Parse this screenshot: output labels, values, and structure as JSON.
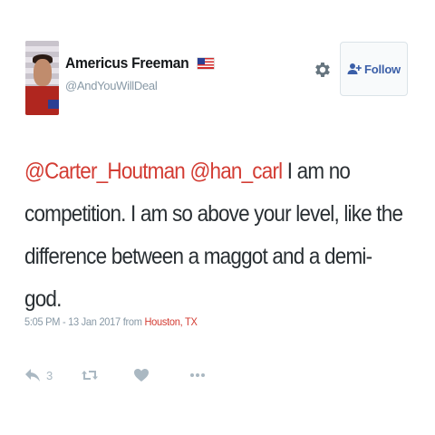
{
  "user": {
    "display_name": "Americus Freeman",
    "handle": "@AndYouWillDeal"
  },
  "follow_button": {
    "label": "Follow"
  },
  "tweet": {
    "mention1": "@Carter_Houtman",
    "mention2": "@han_carl",
    "text": " I am no competition. I am so above your level, like the difference between a maggot and a demi-god."
  },
  "meta": {
    "time_date": "5:05 PM - 13 Jan 2017 from ",
    "place": "Houston, TX"
  },
  "actions": {
    "reply_count": "3"
  },
  "icons": {
    "settings": "gear-icon",
    "follow": "add-user-icon",
    "reply": "reply-icon",
    "retweet": "retweet-icon",
    "like": "heart-icon",
    "more": "more-dots-icon",
    "flag": "us-flag-icon"
  },
  "colors": {
    "mention": "#d33c33",
    "follow_text": "#3b5fa8",
    "muted": "#8899a6",
    "action_icons": "#aab8c2"
  }
}
